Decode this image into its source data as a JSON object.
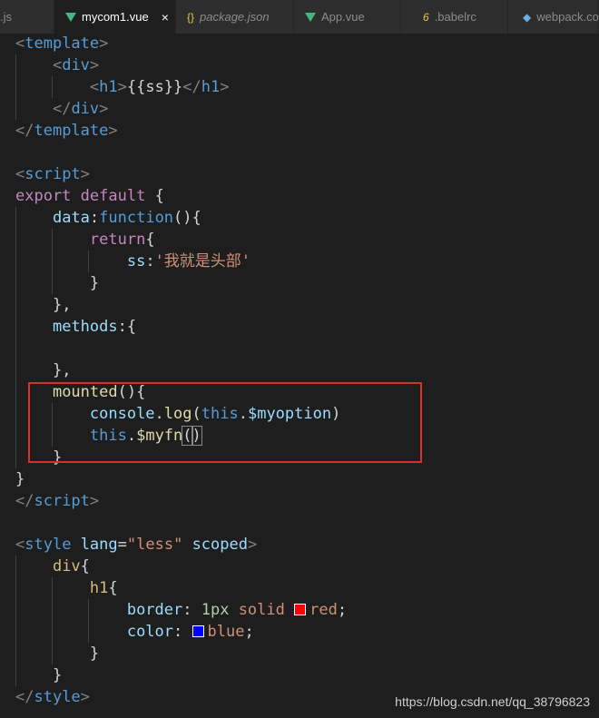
{
  "tabs": [
    {
      "label": ".js",
      "icon": "js-file-icon",
      "active": false
    },
    {
      "label": "mycom1.vue",
      "icon": "vue-file-icon",
      "active": true
    },
    {
      "label": "package.json",
      "icon": "json-braces-icon",
      "active": false
    },
    {
      "label": "App.vue",
      "icon": "vue-file-icon",
      "active": false
    },
    {
      "label": ".babelrc",
      "icon": "babelrc-icon",
      "active": false
    },
    {
      "label": "webpack.co",
      "icon": "webpack-cube-icon",
      "active": false
    }
  ],
  "close_glyph": "×",
  "code": {
    "l01": "template",
    "l02": "div",
    "l03a": "h1",
    "l03b": "{{ss}}",
    "l03c": "h1",
    "l04": "div",
    "l05": "template",
    "l07": "script",
    "l08a": "export",
    "l08b": "default",
    "l08c": "{",
    "l09a": "data",
    "l09b": ":",
    "l09c": "function",
    "l09d": "(){",
    "l10a": "return",
    "l10b": "{",
    "l11a": "ss",
    "l11b": ":",
    "l11c": "'我就是头部'",
    "l12": "}",
    "l13": "},",
    "l14a": "methods",
    "l14b": ":{",
    "l16": "},",
    "l17a": "mounted",
    "l17b": "(){",
    "l18a": "console",
    "l18b": ".",
    "l18c": "log",
    "l18d": "(",
    "l18e": "this",
    "l18f": ".",
    "l18g": "$myoption",
    "l18h": ")",
    "l19a": "this",
    "l19b": ".",
    "l19c": "$myfn",
    "l19d": "(",
    "l19e": ")",
    "l20": "}",
    "l21": "}",
    "l22": "script",
    "l24a": "style",
    "l24b": "lang",
    "l24c": "=",
    "l24d": "\"less\"",
    "l24e": "scoped",
    "l25a": "div",
    "l25b": "{",
    "l26a": "h1",
    "l26b": "{",
    "l27a": "border",
    "l27b": ": ",
    "l27c": "1px",
    "l27d": " solid ",
    "l27e": "red",
    "l27f": ";",
    "l28a": "color",
    "l28b": ": ",
    "l28c": "blue",
    "l28d": ";",
    "l29": "}",
    "l30": "}",
    "l31": "style"
  },
  "swatches": {
    "red": "#ff0000",
    "blue": "#0000ff"
  },
  "highlight_color": "#e02b2b",
  "watermark": "https://blog.csdn.net/qq_38796823"
}
